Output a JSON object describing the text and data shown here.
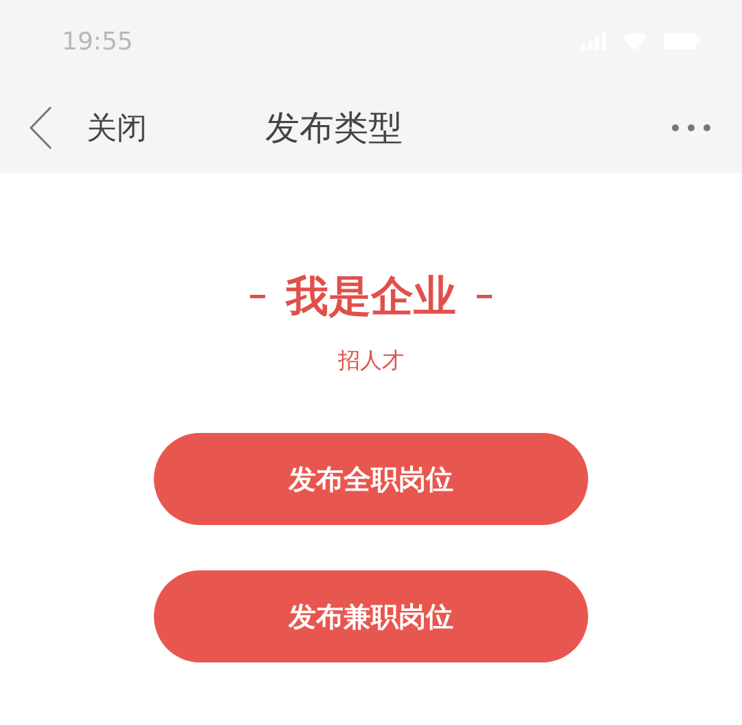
{
  "status_bar": {
    "time": "19:55"
  },
  "nav_bar": {
    "back_label": "关闭",
    "title": "发布类型"
  },
  "section": {
    "title": "我是企业",
    "subtitle": "招人才"
  },
  "buttons": [
    {
      "label": "发布全职岗位"
    },
    {
      "label": "发布兼职岗位"
    }
  ]
}
